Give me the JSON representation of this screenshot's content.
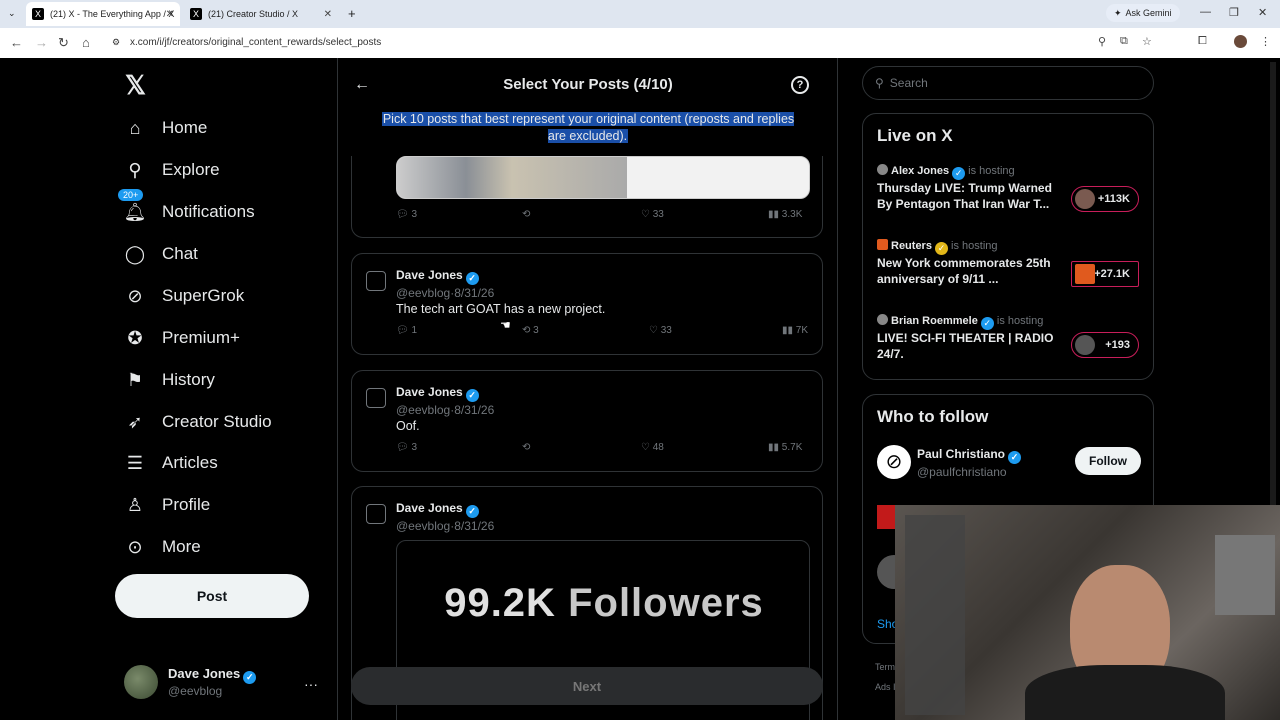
{
  "browser": {
    "tabs": [
      {
        "title": "(21) X - The Everything App / X"
      },
      {
        "title": "(21) Creator Studio / X"
      }
    ],
    "url": "x.com/i/jf/creators/original_content_rewards/select_posts",
    "gemini": "Ask Gemini"
  },
  "sidebar": {
    "logo": "𝕏",
    "items": [
      {
        "label": "Home",
        "icon": "home-icon"
      },
      {
        "label": "Explore",
        "icon": "search-icon"
      },
      {
        "label": "Notifications",
        "icon": "bell-icon",
        "badge": "20+"
      },
      {
        "label": "Chat",
        "icon": "chat-icon"
      },
      {
        "label": "SuperGrok",
        "icon": "grok-icon"
      },
      {
        "label": "Premium+",
        "icon": "verified-icon"
      },
      {
        "label": "History",
        "icon": "bookmark-icon"
      },
      {
        "label": "Creator Studio",
        "icon": "rocket-icon"
      },
      {
        "label": "Articles",
        "icon": "article-icon"
      },
      {
        "label": "Profile",
        "icon": "person-icon"
      },
      {
        "label": "More",
        "icon": "more-icon"
      }
    ],
    "post_label": "Post",
    "account": {
      "name": "Dave Jones",
      "handle": "@eevblog"
    }
  },
  "main": {
    "title": "Select Your Posts (4/10)",
    "subtitle": "Pick 10 posts that best represent your original content (reposts and replies are excluded).",
    "posts": [
      {
        "replies": "3",
        "likes": "33",
        "views": "3.3K"
      },
      {
        "name": "Dave Jones",
        "handle": "@eevblog",
        "date": "8/31/26",
        "text": "The tech art GOAT has a new project.",
        "replies": "1",
        "reposts": "3",
        "likes": "33",
        "views": "7K"
      },
      {
        "name": "Dave Jones",
        "handle": "@eevblog",
        "date": "8/31/26",
        "text": "Oof.",
        "replies": "3",
        "likes": "48",
        "views": "5.7K"
      },
      {
        "name": "Dave Jones",
        "handle": "@eevblog",
        "date": "8/31/26",
        "media_big": "99.2K",
        "media_rest": "Followers"
      }
    ],
    "next_label": "Next"
  },
  "right": {
    "search_placeholder": "Search",
    "live_title": "Live on X",
    "live": [
      {
        "host": "Alex Jones",
        "suffix": "is hosting",
        "title": "Thursday LIVE: Trump Warned By Pentagon That Iran War T...",
        "count": "+113K"
      },
      {
        "host": "Reuters",
        "suffix": "is hosting",
        "title": "New York commemorates 25th anniversary of 9/11 ...",
        "count": "+27.1K"
      },
      {
        "host": "Brian Roemmele",
        "suffix": "is hosting",
        "title": "LIVE! SCI-FI THEATER | RADIO 24/7.",
        "count": "+193"
      }
    ],
    "follow_title": "Who to follow",
    "follow": [
      {
        "name": "Paul Christiano",
        "handle": "@paulfchristiano",
        "button": "Follow"
      }
    ],
    "show_more": "Sho",
    "footer": [
      "Term",
      "Ads I"
    ]
  },
  "colors": {
    "accent": "#1d9bf0",
    "live_border": "#c81e5a",
    "highlight": "#1a4fa8"
  }
}
